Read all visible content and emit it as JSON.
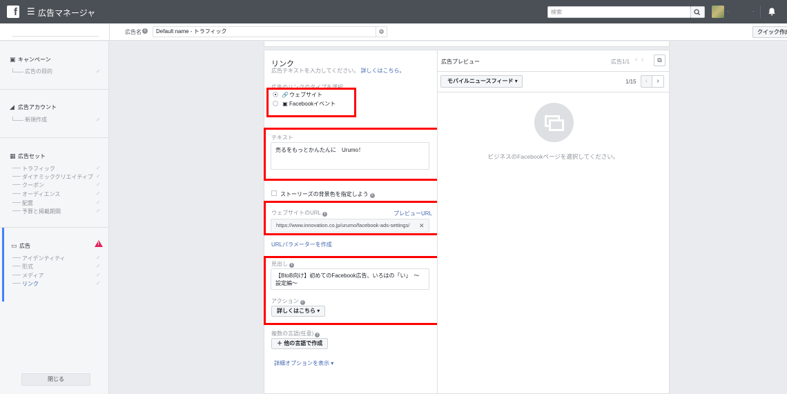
{
  "topbar": {
    "logo": "f",
    "menu_icon": "☰",
    "app_title": "広告マネージャ",
    "search_placeholder": "検索",
    "dot1": "·",
    "dot2": "·"
  },
  "subbar": {
    "name_label": "広告名",
    "name_value": "Default name - トラフィック",
    "quick_button": "クイック作成"
  },
  "sidebar": {
    "campaign": {
      "title": "キャンペーン",
      "items": [
        "広告の目的"
      ]
    },
    "account": {
      "title": "広告アカウント",
      "items": [
        "新規作成"
      ]
    },
    "adset": {
      "title": "広告セット",
      "items": [
        "トラフィック",
        "ダイナミッククリエイティブ",
        "クーポン",
        "オーディエンス",
        "配置",
        "予算と掲載期間"
      ]
    },
    "ad": {
      "title": "広告",
      "items": [
        "アイデンティティ",
        "形式",
        "メディア",
        "リンク"
      ]
    },
    "close_button": "閉じる",
    "check_mark": "✓"
  },
  "link_panel": {
    "title": "リンク",
    "subtitle": "広告テキストを入力してください。",
    "subtitle_link": "詳しくはこちら。",
    "link_type_label": "広告のリンクのタイプを選択",
    "radio_website": "ウェブサイト",
    "radio_event": "Facebookイベント",
    "text_label": "テキスト",
    "text_value": "売るをもっとかんたんに　Urumo！",
    "stories_checkbox": "ストーリーズの背景色を指定しよう",
    "url_label": "ウェブサイトのURL",
    "url_preview_link": "プレビューURL",
    "url_value": "https://www.innovation.co.jp/urumo/facebook-ads-settings/",
    "url_params_link": "URLパラメーターを作成",
    "headline_label": "見出し",
    "headline_value": "【BtoB向け】初めてのFacebook広告、いろはの「い」　～設定編～",
    "action_label": "アクション",
    "action_value": "詳しくはこちら",
    "multilang_label": "複数の言語(任意)",
    "multilang_button": "他の言語で作成",
    "detail_options": "詳細オプションを表示"
  },
  "preview": {
    "title": "広告プレビュー",
    "count": "広告1/1",
    "placement_dropdown": "モバイルニュースフィード",
    "page_count": "1/15",
    "empty_message": "ビジネスのFacebookページを選択してください。"
  },
  "colors": {
    "topbar": "#4b4f56",
    "link_blue": "#4267b2",
    "highlight_red": "#ff0000",
    "warning": "#e0245e",
    "active_bar": "#4080ff"
  }
}
